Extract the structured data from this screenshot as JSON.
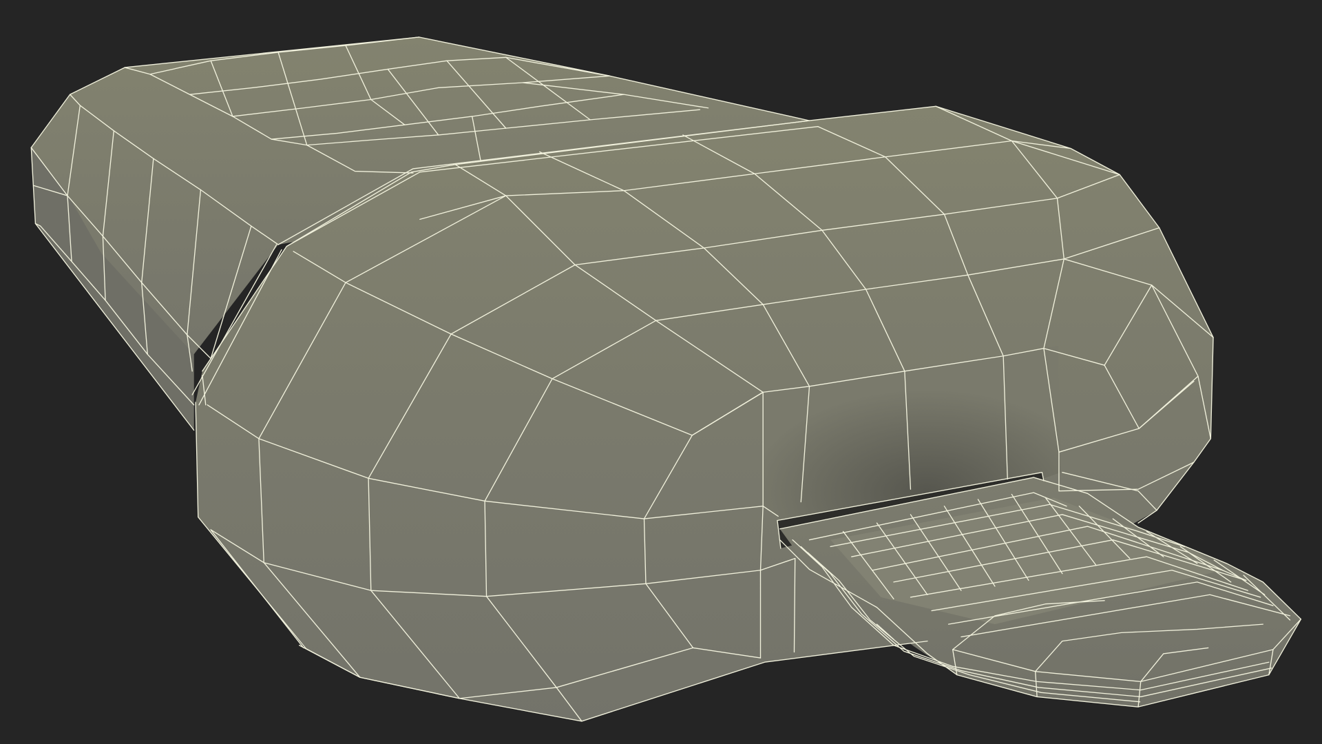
{
  "scene": {
    "subject": "usb-flash-drive-wireframe",
    "colors": {
      "background": "#252525",
      "surface_light": "#80806f",
      "surface_mid": "#76766a",
      "surface_dark": "#5f5f56",
      "slot_dark": "#2a2a28",
      "wire": "#f1f1dc"
    }
  }
}
